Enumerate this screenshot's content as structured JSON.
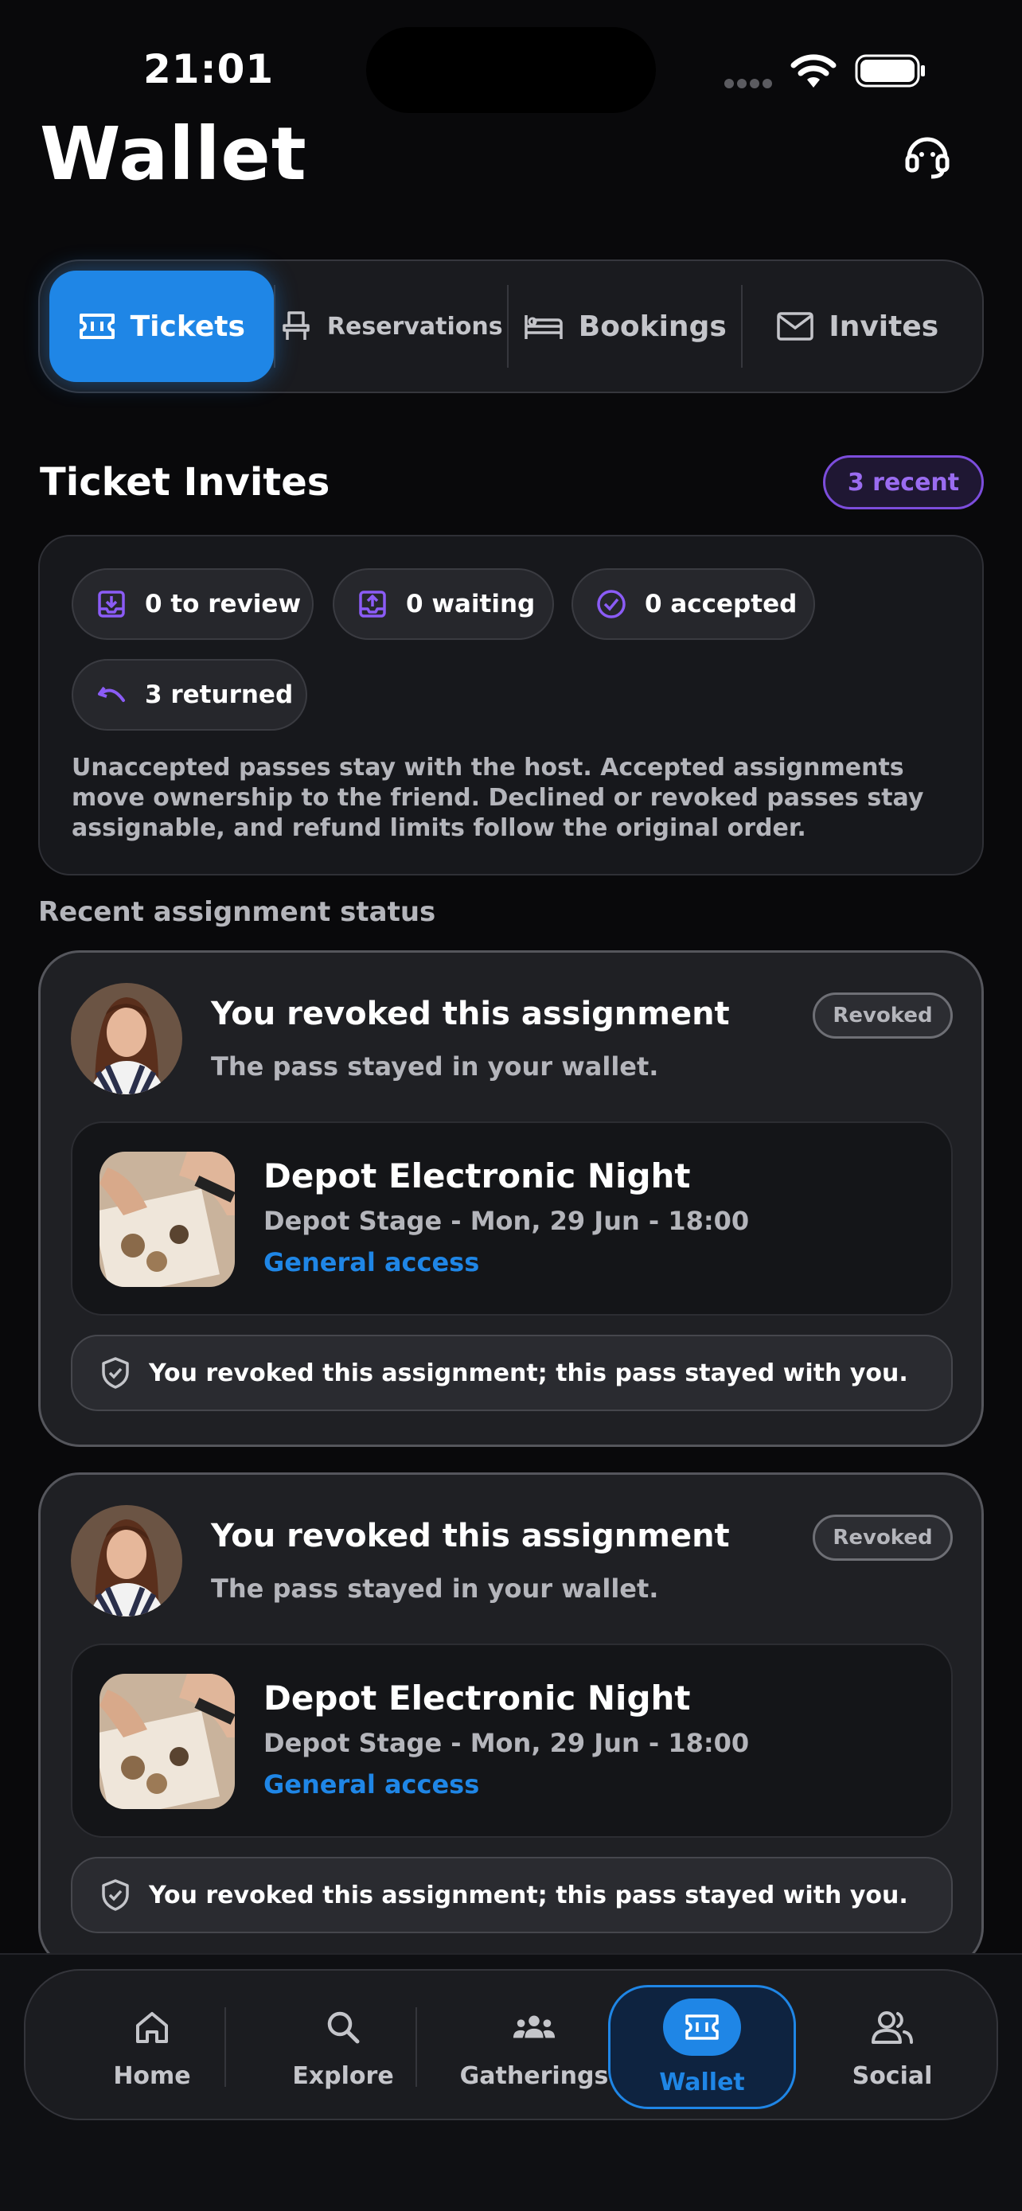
{
  "status_bar": {
    "time": "21:01"
  },
  "header": {
    "title": "Wallet"
  },
  "segments": [
    {
      "label": "Tickets",
      "active": true
    },
    {
      "label": "Reservations",
      "active": false
    },
    {
      "label": "Bookings",
      "active": false
    },
    {
      "label": "Invites",
      "active": false
    }
  ],
  "section": {
    "title": "Ticket Invites",
    "recent_badge": "3 recent"
  },
  "summary": {
    "chips": [
      {
        "label": "0 to review"
      },
      {
        "label": "0 waiting"
      },
      {
        "label": "0 accepted"
      },
      {
        "label": "3 returned"
      }
    ],
    "note": "Unaccepted passes stay with the host. Accepted assignments move ownership to the friend. Declined or revoked passes stay assignable, and refund limits follow the original order."
  },
  "recent_status_title": "Recent assignment status",
  "assignments": [
    {
      "title": "You revoked this assignment",
      "subtitle": "The pass stayed in your wallet.",
      "badge": "Revoked",
      "event_name": "Depot Electronic Night",
      "event_meta": "Depot Stage - Mon, 29 Jun - 18:00",
      "access": "General access",
      "footer": "You revoked this assignment; this pass stayed with you."
    },
    {
      "title": "You revoked this assignment",
      "subtitle": "The pass stayed in your wallet.",
      "badge": "Revoked",
      "event_name": "Depot Electronic Night",
      "event_meta": "Depot Stage - Mon, 29 Jun - 18:00",
      "access": "General access",
      "footer": "You revoked this assignment; this pass stayed with you."
    }
  ],
  "tabbar": [
    {
      "label": "Home",
      "icon": "home-icon"
    },
    {
      "label": "Explore",
      "icon": "search-icon"
    },
    {
      "label": "Gatherings",
      "icon": "people-group-icon"
    },
    {
      "label": "Wallet",
      "icon": "ticket-icon",
      "active": true
    },
    {
      "label": "Social",
      "icon": "users-icon"
    }
  ],
  "colors": {
    "accent": "#1f86e6",
    "purple": "#7c4ddc",
    "background": "#09090b"
  }
}
